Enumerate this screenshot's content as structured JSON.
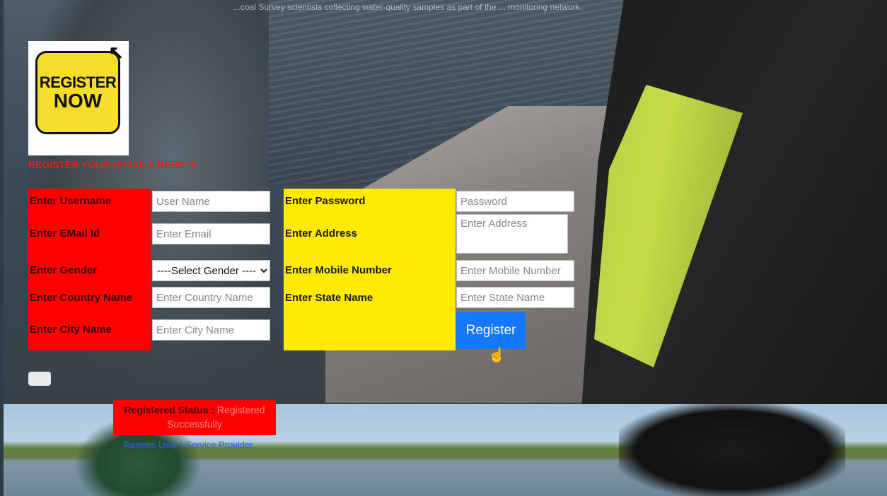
{
  "background": {
    "top_caption": "...coal Survey scientists collecting water-quality samples as part of the ... monitoring network."
  },
  "badge": {
    "line1": "REGISTER",
    "line2": "NOW",
    "icon": "cursor-arrow-icon"
  },
  "form": {
    "title": "REGISTER YOUR DETAILS HERE !!!",
    "left": {
      "username_label": "Enter Username",
      "username_placeholder": "User Name",
      "email_label": "Enter EMail Id",
      "email_placeholder": "Enter Email",
      "gender_label": "Enter Gender",
      "gender_selected": "----Select Gender ----",
      "country_label": "Enter Country Name",
      "country_placeholder": "Enter Country Name",
      "city_label": "Enter City Name",
      "city_placeholder": "Enter City Name"
    },
    "right": {
      "password_label": "Enter Password",
      "password_placeholder": "Password",
      "address_label": "Enter Address",
      "address_placeholder": "Enter Address",
      "mobile_label": "Enter Mobile Number",
      "mobile_placeholder": "Enter Mobile Number",
      "state_label": "Enter State Name",
      "state_placeholder": "Enter State Name"
    },
    "register_button": "Register"
  },
  "status": {
    "label": "Registered Status :",
    "message": "Registered Successfully",
    "links": "Remote User | Service Provider"
  },
  "colors": {
    "red_panel": "#ff0000",
    "yellow_panel": "#ffea00",
    "button": "#1478ff"
  }
}
